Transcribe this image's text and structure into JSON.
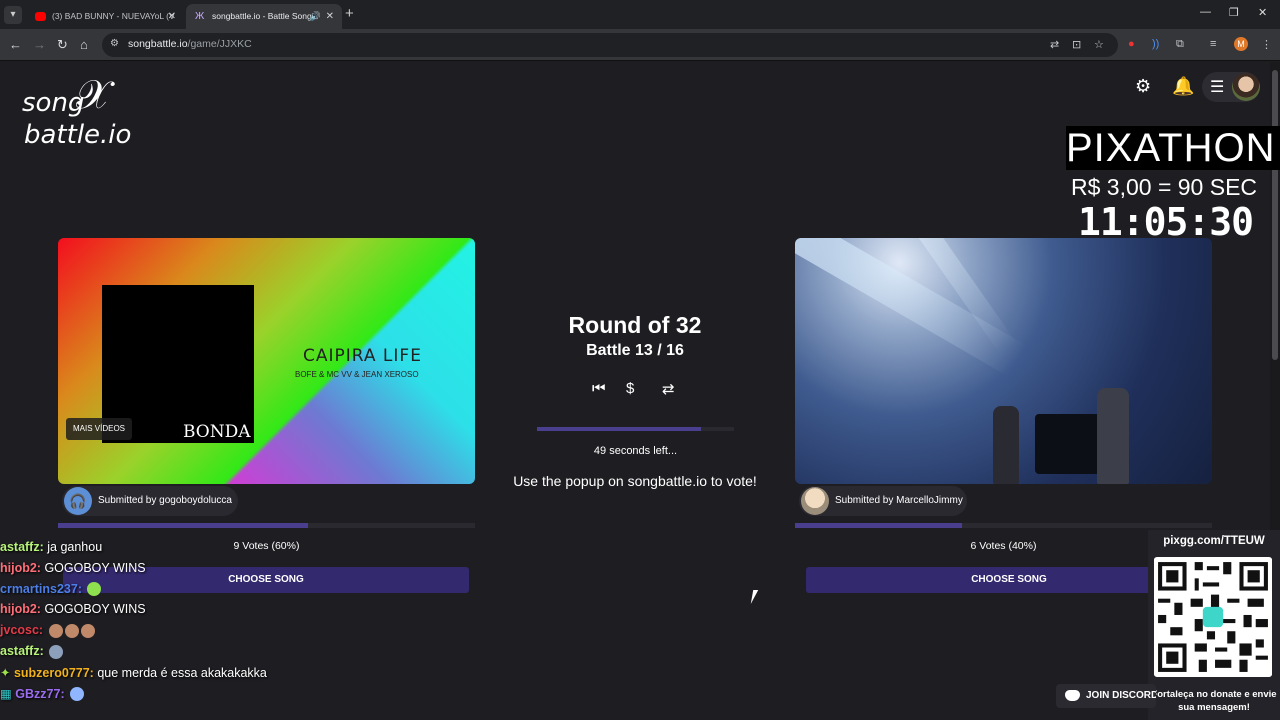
{
  "browser": {
    "tabs": [
      {
        "label": "(3) BAD BUNNY - NUEVAYoL (V",
        "favicon": "youtube-icon"
      },
      {
        "label": "songbattle.io - Battle Songs",
        "favicon": "songbattle-icon"
      }
    ],
    "url_host": "songbattle.io",
    "url_path": "/game/JJXKC",
    "profile_initial": "M"
  },
  "logo": {
    "line1": "song",
    "line2": "battle.io"
  },
  "overlay": {
    "pix_title": "PIXATHON",
    "pix_price": "R$ 3,00 = 90 SEC",
    "pix_timer": "11:05:30",
    "qr_url": "pixgg.com/TTEUW",
    "qr_note": "Fortaleça no donate e envie sua mensagem!",
    "discord_label": "JOIN DISCORD"
  },
  "left_song": {
    "more_videos": "MAIS VÍDEOS",
    "cover_text": "BONDA",
    "title": "CAIPIRA LIFE",
    "artists": "BOFE & MC VV & JEAN XEROSO",
    "submitted_by": "Submitted by gogoboydolucca",
    "votes": "9 Votes (60%)",
    "vote_fraction": 0.6,
    "choose_label": "CHOOSE SONG"
  },
  "right_song": {
    "submitted_by": "Submitted by MarcelloJimmy",
    "votes": "6 Votes (40%)",
    "vote_fraction": 0.4,
    "choose_label": "CHOOSE SONG"
  },
  "center": {
    "round": "Round of 32",
    "battle": "Battle 13 / 16",
    "time_left": "49 seconds left...",
    "time_fraction": 0.83,
    "instructions": "Use the popup on songbattle.io to vote!"
  },
  "chat": [
    {
      "user": "astaffz:",
      "text": "ja ganhou",
      "color": "#b7f27a"
    },
    {
      "user": "hijob2:",
      "text": "GOGOBOY WINS",
      "color": "#ff6f7a"
    },
    {
      "user": "crmartins237:",
      "text": "",
      "color": "#4d7fe8"
    },
    {
      "user": "hijob2:",
      "text": "GOGOBOY WINS",
      "color": "#ff6f7a"
    },
    {
      "user": "jvcosc:",
      "text": "",
      "color": "#e23b4a"
    },
    {
      "user": "astaffz:",
      "text": "",
      "color": "#b7f27a"
    },
    {
      "user": "subzero0777:",
      "text": "que merda é essa akakakakka",
      "color": "#f2b21b"
    },
    {
      "user": "GBzz77:",
      "text": "",
      "color": "#9a6cf0"
    }
  ]
}
